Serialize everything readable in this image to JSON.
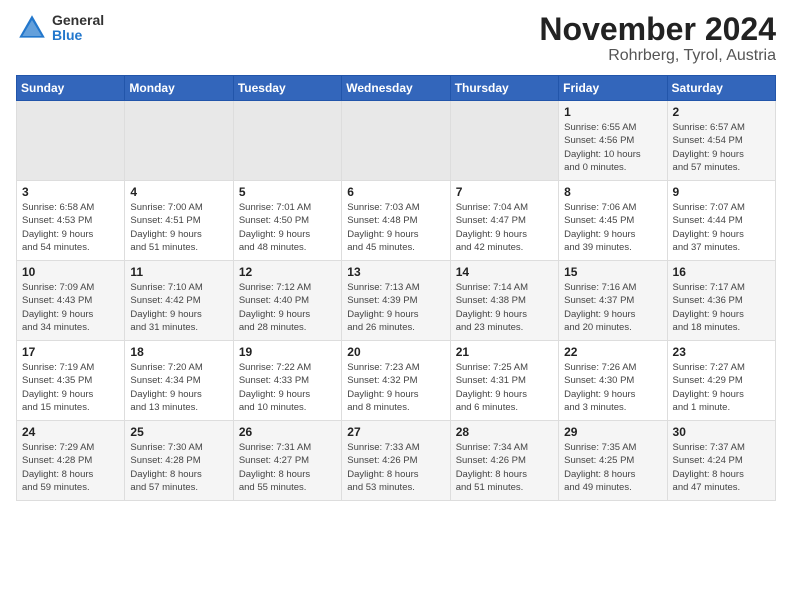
{
  "logo": {
    "general": "General",
    "blue": "Blue"
  },
  "title": "November 2024",
  "location": "Rohrberg, Tyrol, Austria",
  "days_of_week": [
    "Sunday",
    "Monday",
    "Tuesday",
    "Wednesday",
    "Thursday",
    "Friday",
    "Saturday"
  ],
  "weeks": [
    [
      {
        "day": "",
        "info": ""
      },
      {
        "day": "",
        "info": ""
      },
      {
        "day": "",
        "info": ""
      },
      {
        "day": "",
        "info": ""
      },
      {
        "day": "",
        "info": ""
      },
      {
        "day": "1",
        "info": "Sunrise: 6:55 AM\nSunset: 4:56 PM\nDaylight: 10 hours\nand 0 minutes."
      },
      {
        "day": "2",
        "info": "Sunrise: 6:57 AM\nSunset: 4:54 PM\nDaylight: 9 hours\nand 57 minutes."
      }
    ],
    [
      {
        "day": "3",
        "info": "Sunrise: 6:58 AM\nSunset: 4:53 PM\nDaylight: 9 hours\nand 54 minutes."
      },
      {
        "day": "4",
        "info": "Sunrise: 7:00 AM\nSunset: 4:51 PM\nDaylight: 9 hours\nand 51 minutes."
      },
      {
        "day": "5",
        "info": "Sunrise: 7:01 AM\nSunset: 4:50 PM\nDaylight: 9 hours\nand 48 minutes."
      },
      {
        "day": "6",
        "info": "Sunrise: 7:03 AM\nSunset: 4:48 PM\nDaylight: 9 hours\nand 45 minutes."
      },
      {
        "day": "7",
        "info": "Sunrise: 7:04 AM\nSunset: 4:47 PM\nDaylight: 9 hours\nand 42 minutes."
      },
      {
        "day": "8",
        "info": "Sunrise: 7:06 AM\nSunset: 4:45 PM\nDaylight: 9 hours\nand 39 minutes."
      },
      {
        "day": "9",
        "info": "Sunrise: 7:07 AM\nSunset: 4:44 PM\nDaylight: 9 hours\nand 37 minutes."
      }
    ],
    [
      {
        "day": "10",
        "info": "Sunrise: 7:09 AM\nSunset: 4:43 PM\nDaylight: 9 hours\nand 34 minutes."
      },
      {
        "day": "11",
        "info": "Sunrise: 7:10 AM\nSunset: 4:42 PM\nDaylight: 9 hours\nand 31 minutes."
      },
      {
        "day": "12",
        "info": "Sunrise: 7:12 AM\nSunset: 4:40 PM\nDaylight: 9 hours\nand 28 minutes."
      },
      {
        "day": "13",
        "info": "Sunrise: 7:13 AM\nSunset: 4:39 PM\nDaylight: 9 hours\nand 26 minutes."
      },
      {
        "day": "14",
        "info": "Sunrise: 7:14 AM\nSunset: 4:38 PM\nDaylight: 9 hours\nand 23 minutes."
      },
      {
        "day": "15",
        "info": "Sunrise: 7:16 AM\nSunset: 4:37 PM\nDaylight: 9 hours\nand 20 minutes."
      },
      {
        "day": "16",
        "info": "Sunrise: 7:17 AM\nSunset: 4:36 PM\nDaylight: 9 hours\nand 18 minutes."
      }
    ],
    [
      {
        "day": "17",
        "info": "Sunrise: 7:19 AM\nSunset: 4:35 PM\nDaylight: 9 hours\nand 15 minutes."
      },
      {
        "day": "18",
        "info": "Sunrise: 7:20 AM\nSunset: 4:34 PM\nDaylight: 9 hours\nand 13 minutes."
      },
      {
        "day": "19",
        "info": "Sunrise: 7:22 AM\nSunset: 4:33 PM\nDaylight: 9 hours\nand 10 minutes."
      },
      {
        "day": "20",
        "info": "Sunrise: 7:23 AM\nSunset: 4:32 PM\nDaylight: 9 hours\nand 8 minutes."
      },
      {
        "day": "21",
        "info": "Sunrise: 7:25 AM\nSunset: 4:31 PM\nDaylight: 9 hours\nand 6 minutes."
      },
      {
        "day": "22",
        "info": "Sunrise: 7:26 AM\nSunset: 4:30 PM\nDaylight: 9 hours\nand 3 minutes."
      },
      {
        "day": "23",
        "info": "Sunrise: 7:27 AM\nSunset: 4:29 PM\nDaylight: 9 hours\nand 1 minute."
      }
    ],
    [
      {
        "day": "24",
        "info": "Sunrise: 7:29 AM\nSunset: 4:28 PM\nDaylight: 8 hours\nand 59 minutes."
      },
      {
        "day": "25",
        "info": "Sunrise: 7:30 AM\nSunset: 4:28 PM\nDaylight: 8 hours\nand 57 minutes."
      },
      {
        "day": "26",
        "info": "Sunrise: 7:31 AM\nSunset: 4:27 PM\nDaylight: 8 hours\nand 55 minutes."
      },
      {
        "day": "27",
        "info": "Sunrise: 7:33 AM\nSunset: 4:26 PM\nDaylight: 8 hours\nand 53 minutes."
      },
      {
        "day": "28",
        "info": "Sunrise: 7:34 AM\nSunset: 4:26 PM\nDaylight: 8 hours\nand 51 minutes."
      },
      {
        "day": "29",
        "info": "Sunrise: 7:35 AM\nSunset: 4:25 PM\nDaylight: 8 hours\nand 49 minutes."
      },
      {
        "day": "30",
        "info": "Sunrise: 7:37 AM\nSunset: 4:24 PM\nDaylight: 8 hours\nand 47 minutes."
      }
    ]
  ]
}
